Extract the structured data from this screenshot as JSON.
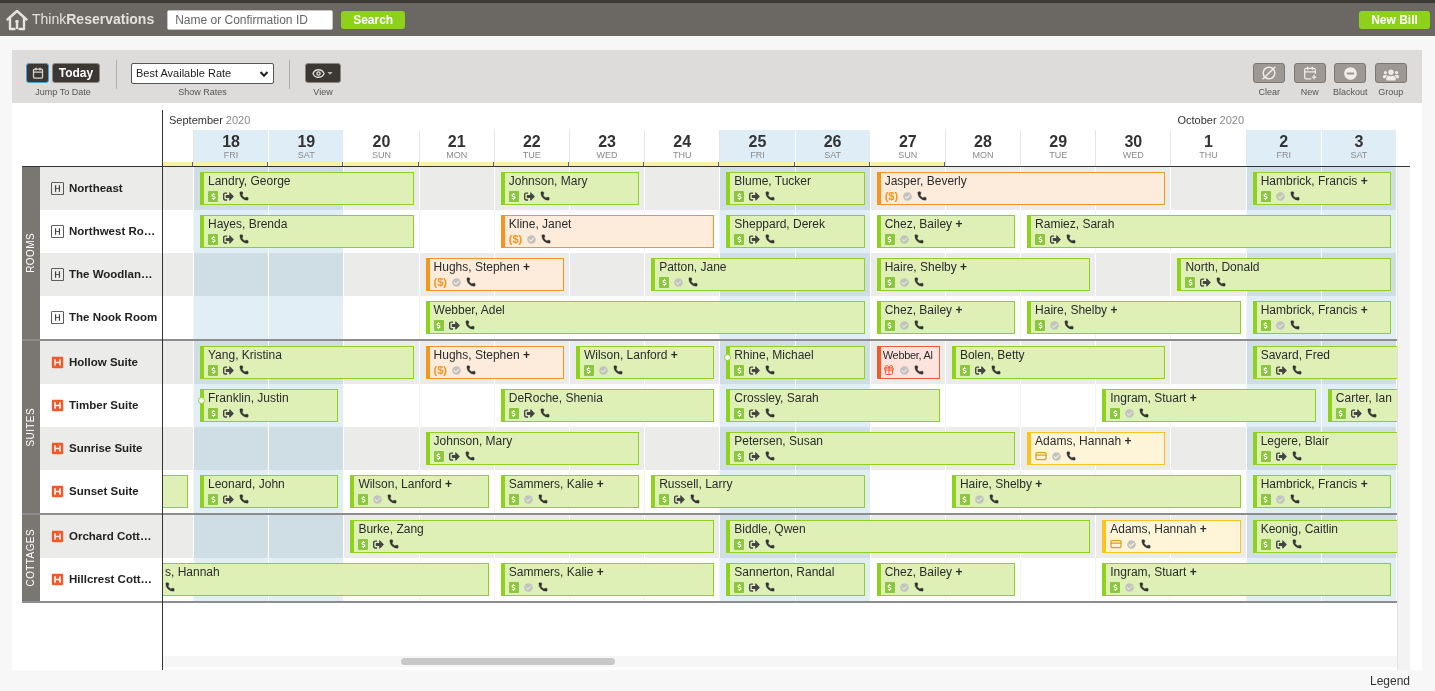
{
  "top_bar": {
    "logo": "Think**Reservations**",
    "search": {
      "placeholder": "Name or Confirmation ID"
    },
    "search_button": "Search",
    "new_bill_button": "New Bill"
  },
  "toolbar": {
    "calendar_button": {
      "focused": true
    },
    "today_button": "Today",
    "jump_label": "Jump To Date",
    "rate_select": {
      "value": "Best Available Rate",
      "label": "Show Rates"
    },
    "view": {
      "label": "View"
    },
    "actions": [
      {
        "kind": "clear",
        "label": "Clear"
      },
      {
        "kind": "new",
        "label": "New"
      },
      {
        "kind": "blackout",
        "label": "Blackout"
      },
      {
        "kind": "group",
        "label": "Group"
      }
    ]
  },
  "calendar": {
    "days": [
      {
        "month": {
          "name": "September",
          "year": "2020"
        },
        "weekend": false,
        "season": true
      },
      {
        "day": "18",
        "weekday": "FRI",
        "weekend": true,
        "season": true
      },
      {
        "day": "19",
        "weekday": "SAT",
        "weekend": true,
        "season": true
      },
      {
        "day": "20",
        "weekday": "SUN",
        "weekend": false,
        "season": true
      },
      {
        "day": "21",
        "weekday": "MON",
        "weekend": false,
        "season": true
      },
      {
        "day": "22",
        "weekday": "TUE",
        "weekend": false,
        "season": true
      },
      {
        "day": "23",
        "weekday": "WED",
        "weekend": false,
        "season": true
      },
      {
        "day": "24",
        "weekday": "THU",
        "weekend": false,
        "season": true
      },
      {
        "day": "25",
        "weekday": "FRI",
        "weekend": true,
        "season": true
      },
      {
        "day": "26",
        "weekday": "SAT",
        "weekend": true,
        "season": true
      },
      {
        "day": "27",
        "weekday": "SUN",
        "weekend": false,
        "season": true
      },
      {
        "day": "28",
        "weekday": "MON",
        "weekend": false,
        "season": false
      },
      {
        "day": "29",
        "weekday": "TUE",
        "weekend": false,
        "season": false
      },
      {
        "day": "30",
        "weekday": "WED",
        "weekend": false,
        "season": false
      },
      {
        "day": "1",
        "weekday": "THU",
        "weekend": false,
        "season": false,
        "month": {
          "name": "October",
          "year": "2020"
        }
      },
      {
        "day": "2",
        "weekday": "FRI",
        "weekend": true,
        "season": false
      },
      {
        "day": "3",
        "weekday": "SAT",
        "weekend": true,
        "season": false
      }
    ],
    "groups": [
      {
        "label": "ROOMS",
        "rooms": [
          {
            "name": "Northeast",
            "kind": "outline",
            "cells": [
              {
                "kind": "free"
              },
              {
                "kind": "confirmed",
                "guest": "Landry, George",
                "icons": [
                  {
                    "kind": "paid"
                  },
                  {
                    "kind": "checked_in"
                  },
                  {
                    "kind": "phone"
                  }
                ],
                "open_start": false,
                "open_end": false,
                "marker": false
              },
              {
                "kind": "continued"
              },
              {
                "kind": "continued"
              },
              {
                "kind": "free"
              },
              {
                "kind": "confirmed",
                "guest": "Johnson, Mary",
                "icons": [
                  {
                    "kind": "paid"
                  },
                  {
                    "kind": "checked_in"
                  },
                  {
                    "kind": "phone"
                  }
                ],
                "open_start": false,
                "open_end": false,
                "marker": false
              },
              {
                "kind": "continued"
              },
              {
                "kind": "free"
              },
              {
                "kind": "confirmed",
                "guest": "Blume, Tucker",
                "icons": [
                  {
                    "kind": "paid"
                  },
                  {
                    "kind": "checked_in"
                  },
                  {
                    "kind": "phone"
                  }
                ],
                "open_start": false,
                "open_end": false,
                "marker": false
              },
              {
                "kind": "continued"
              },
              {
                "kind": "unpaid",
                "guest": "Jasper, Beverly",
                "icons": [
                  {
                    "kind": "due",
                    "label": "($)"
                  },
                  {
                    "kind": "verified"
                  },
                  {
                    "kind": "phone"
                  }
                ],
                "open_start": false,
                "open_end": false,
                "marker": false
              },
              {
                "kind": "continued"
              },
              {
                "kind": "continued"
              },
              {
                "kind": "continued"
              },
              {
                "kind": "free"
              },
              {
                "kind": "confirmed",
                "guest": "Hambrick, Francis **+**",
                "icons": [
                  {
                    "kind": "paid"
                  },
                  {
                    "kind": "verified"
                  },
                  {
                    "kind": "phone"
                  }
                ],
                "open_start": false,
                "open_end": false,
                "marker": false
              },
              {
                "kind": "continued"
              }
            ]
          },
          {
            "name": "Northwest Ro…",
            "kind": "outline",
            "cells": [
              {
                "kind": "free"
              },
              {
                "kind": "confirmed",
                "guest": "Hayes, Brenda",
                "icons": [
                  {
                    "kind": "paid"
                  },
                  {
                    "kind": "checked_in"
                  },
                  {
                    "kind": "phone"
                  }
                ],
                "open_start": false,
                "open_end": false,
                "marker": false
              },
              {
                "kind": "continued"
              },
              {
                "kind": "continued"
              },
              {
                "kind": "free"
              },
              {
                "kind": "unpaid",
                "guest": "Kline, Janet",
                "icons": [
                  {
                    "kind": "due",
                    "label": "($)"
                  },
                  {
                    "kind": "verified"
                  },
                  {
                    "kind": "phone"
                  }
                ],
                "open_start": false,
                "open_end": false,
                "marker": false
              },
              {
                "kind": "continued"
              },
              {
                "kind": "continued"
              },
              {
                "kind": "confirmed",
                "guest": "Sheppard, Derek",
                "icons": [
                  {
                    "kind": "paid"
                  },
                  {
                    "kind": "checked_in"
                  },
                  {
                    "kind": "phone"
                  }
                ],
                "open_start": false,
                "open_end": false,
                "marker": false
              },
              {
                "kind": "continued"
              },
              {
                "kind": "confirmed",
                "guest": "Chez, Bailey **+**",
                "icons": [
                  {
                    "kind": "paid"
                  },
                  {
                    "kind": "verified"
                  },
                  {
                    "kind": "phone"
                  }
                ],
                "open_start": false,
                "open_end": false,
                "marker": false
              },
              {
                "kind": "continued"
              },
              {
                "kind": "confirmed",
                "guest": "Ramiez, Sarah",
                "icons": [
                  {
                    "kind": "paid"
                  },
                  {
                    "kind": "checked_in"
                  },
                  {
                    "kind": "phone"
                  }
                ],
                "open_start": false,
                "open_end": false,
                "marker": false
              },
              {
                "kind": "continued"
              },
              {
                "kind": "continued"
              },
              {
                "kind": "continued"
              },
              {
                "kind": "continued"
              }
            ]
          },
          {
            "name": "The Woodlan…",
            "kind": "outline",
            "cells": [
              {
                "kind": "free"
              },
              {
                "kind": "free"
              },
              {
                "kind": "free"
              },
              {
                "kind": "free"
              },
              {
                "kind": "unpaid",
                "guest": "Hughs, Stephen **+**",
                "icons": [
                  {
                    "kind": "due",
                    "label": "($)"
                  },
                  {
                    "kind": "verified"
                  },
                  {
                    "kind": "phone"
                  }
                ],
                "open_start": false,
                "open_end": false,
                "marker": false
              },
              {
                "kind": "continued"
              },
              {
                "kind": "free"
              },
              {
                "kind": "confirmed",
                "guest": "Patton, Jane",
                "icons": [
                  {
                    "kind": "paid"
                  },
                  {
                    "kind": "verified"
                  },
                  {
                    "kind": "phone"
                  }
                ],
                "open_start": false,
                "open_end": false,
                "marker": false
              },
              {
                "kind": "continued"
              },
              {
                "kind": "continued"
              },
              {
                "kind": "confirmed",
                "guest": "Haire, Shelby **+**",
                "icons": [
                  {
                    "kind": "paid"
                  },
                  {
                    "kind": "verified"
                  },
                  {
                    "kind": "phone"
                  }
                ],
                "open_start": false,
                "open_end": false,
                "marker": false
              },
              {
                "kind": "continued"
              },
              {
                "kind": "continued"
              },
              {
                "kind": "free"
              },
              {
                "kind": "confirmed",
                "guest": "North, Donald",
                "icons": [
                  {
                    "kind": "paid"
                  },
                  {
                    "kind": "checked_in"
                  },
                  {
                    "kind": "phone"
                  }
                ],
                "open_start": false,
                "open_end": false,
                "marker": false
              },
              {
                "kind": "continued"
              },
              {
                "kind": "continued"
              }
            ]
          },
          {
            "name": "The Nook Room",
            "kind": "outline",
            "cells": [
              {
                "kind": "free"
              },
              {
                "kind": "free"
              },
              {
                "kind": "free"
              },
              {
                "kind": "free"
              },
              {
                "kind": "confirmed",
                "guest": "Webber, Adel",
                "icons": [
                  {
                    "kind": "paid"
                  },
                  {
                    "kind": "checked_in"
                  },
                  {
                    "kind": "phone"
                  }
                ],
                "open_start": false,
                "open_end": false,
                "marker": false
              },
              {
                "kind": "continued"
              },
              {
                "kind": "continued"
              },
              {
                "kind": "continued"
              },
              {
                "kind": "continued"
              },
              {
                "kind": "continued"
              },
              {
                "kind": "confirmed",
                "guest": "Chez, Bailey **+**",
                "icons": [
                  {
                    "kind": "paid"
                  },
                  {
                    "kind": "verified"
                  },
                  {
                    "kind": "phone"
                  }
                ],
                "open_start": false,
                "open_end": false,
                "marker": false
              },
              {
                "kind": "continued"
              },
              {
                "kind": "confirmed",
                "guest": "Haire, Shelby **+**",
                "icons": [
                  {
                    "kind": "paid"
                  },
                  {
                    "kind": "verified"
                  },
                  {
                    "kind": "phone"
                  }
                ],
                "open_start": false,
                "open_end": false,
                "marker": false
              },
              {
                "kind": "continued"
              },
              {
                "kind": "continued"
              },
              {
                "kind": "confirmed",
                "guest": "Hambrick, Francis **+**",
                "icons": [
                  {
                    "kind": "paid"
                  },
                  {
                    "kind": "verified"
                  },
                  {
                    "kind": "phone"
                  }
                ],
                "open_start": false,
                "open_end": false,
                "marker": false
              },
              {
                "kind": "continued"
              }
            ]
          }
        ]
      },
      {
        "label": "SUITES",
        "rooms": [
          {
            "name": "Hollow Suite",
            "kind": "filled",
            "cells": [
              {
                "kind": "free"
              },
              {
                "kind": "confirmed",
                "guest": "Yang, Kristina",
                "icons": [
                  {
                    "kind": "paid"
                  },
                  {
                    "kind": "checked_in"
                  },
                  {
                    "kind": "phone"
                  }
                ],
                "open_start": false,
                "open_end": false,
                "marker": false
              },
              {
                "kind": "continued"
              },
              {
                "kind": "continued"
              },
              {
                "kind": "unpaid",
                "guest": "Hughs, Stephen **+**",
                "icons": [
                  {
                    "kind": "due",
                    "label": "($)"
                  },
                  {
                    "kind": "verified"
                  },
                  {
                    "kind": "phone"
                  }
                ],
                "open_start": false,
                "open_end": false,
                "marker": false
              },
              {
                "kind": "continued"
              },
              {
                "kind": "confirmed",
                "guest": "Wilson, Lanford **+**",
                "icons": [
                  {
                    "kind": "paid"
                  },
                  {
                    "kind": "verified"
                  },
                  {
                    "kind": "phone"
                  }
                ],
                "open_start": false,
                "open_end": false,
                "marker": false
              },
              {
                "kind": "continued"
              },
              {
                "kind": "confirmed",
                "guest": "Rhine, Michael",
                "icons": [
                  {
                    "kind": "paid"
                  },
                  {
                    "kind": "checked_in"
                  },
                  {
                    "kind": "phone"
                  }
                ],
                "open_start": false,
                "open_end": false,
                "marker": true
              },
              {
                "kind": "continued"
              },
              {
                "kind": "issue",
                "guest": "Webber, Al",
                "icons": [
                  {
                    "kind": "gift"
                  },
                  {
                    "kind": "verified"
                  },
                  {
                    "kind": "phone"
                  }
                ],
                "open_start": false,
                "open_end": false,
                "marker": false
              },
              {
                "kind": "confirmed",
                "guest": "Bolen, Betty",
                "icons": [
                  {
                    "kind": "paid"
                  },
                  {
                    "kind": "checked_in"
                  },
                  {
                    "kind": "phone"
                  }
                ],
                "open_start": false,
                "open_end": false,
                "marker": false
              },
              {
                "kind": "continued"
              },
              {
                "kind": "continued"
              },
              {
                "kind": "free"
              },
              {
                "kind": "confirmed",
                "guest": "Savard, Fred",
                "icons": [
                  {
                    "kind": "paid"
                  },
                  {
                    "kind": "checked_in"
                  },
                  {
                    "kind": "phone"
                  }
                ],
                "open_start": false,
                "open_end": true,
                "marker": false
              },
              {
                "kind": "continued"
              }
            ]
          },
          {
            "name": "Timber Suite",
            "kind": "filled",
            "cells": [
              {
                "kind": "free"
              },
              {
                "kind": "confirmed",
                "guest": "Franklin, Justin",
                "icons": [
                  {
                    "kind": "paid"
                  },
                  {
                    "kind": "checked_in"
                  },
                  {
                    "kind": "phone"
                  }
                ],
                "open_start": false,
                "open_end": false,
                "marker": true
              },
              {
                "kind": "continued"
              },
              {
                "kind": "free"
              },
              {
                "kind": "free"
              },
              {
                "kind": "confirmed",
                "guest": "DeRoche, Shenia",
                "icons": [
                  {
                    "kind": "paid"
                  },
                  {
                    "kind": "checked_in"
                  },
                  {
                    "kind": "phone"
                  }
                ],
                "open_start": false,
                "open_end": false,
                "marker": false
              },
              {
                "kind": "continued"
              },
              {
                "kind": "continued"
              },
              {
                "kind": "confirmed",
                "guest": "Crossley, Sarah",
                "icons": [
                  {
                    "kind": "paid"
                  },
                  {
                    "kind": "checked_in"
                  },
                  {
                    "kind": "phone"
                  }
                ],
                "open_start": false,
                "open_end": false,
                "marker": false
              },
              {
                "kind": "continued"
              },
              {
                "kind": "continued"
              },
              {
                "kind": "free"
              },
              {
                "kind": "free"
              },
              {
                "kind": "confirmed",
                "guest": "Ingram, Stuart **+**",
                "icons": [
                  {
                    "kind": "paid"
                  },
                  {
                    "kind": "verified"
                  },
                  {
                    "kind": "phone"
                  }
                ],
                "open_start": false,
                "open_end": false,
                "marker": false
              },
              {
                "kind": "continued"
              },
              {
                "kind": "continued"
              },
              {
                "kind": "confirmed",
                "guest": "Carter, Ian",
                "icons": [
                  {
                    "kind": "paid"
                  },
                  {
                    "kind": "checked_in"
                  },
                  {
                    "kind": "phone"
                  }
                ],
                "open_start": false,
                "open_end": true,
                "marker": false
              }
            ]
          },
          {
            "name": "Sunrise Suite",
            "kind": "filled",
            "cells": [
              {
                "kind": "free"
              },
              {
                "kind": "free"
              },
              {
                "kind": "free"
              },
              {
                "kind": "free"
              },
              {
                "kind": "confirmed",
                "guest": "Johnson, Mary",
                "icons": [
                  {
                    "kind": "paid"
                  },
                  {
                    "kind": "checked_in"
                  },
                  {
                    "kind": "phone"
                  }
                ],
                "open_start": false,
                "open_end": false,
                "marker": false
              },
              {
                "kind": "continued"
              },
              {
                "kind": "continued"
              },
              {
                "kind": "free"
              },
              {
                "kind": "confirmed",
                "guest": "Petersen, Susan",
                "icons": [
                  {
                    "kind": "paid"
                  },
                  {
                    "kind": "checked_in"
                  },
                  {
                    "kind": "phone"
                  }
                ],
                "open_start": false,
                "open_end": false,
                "marker": false
              },
              {
                "kind": "continued"
              },
              {
                "kind": "continued"
              },
              {
                "kind": "continued"
              },
              {
                "kind": "tentative",
                "guest": "Adams, Hannah **+**",
                "icons": [
                  {
                    "kind": "card"
                  },
                  {
                    "kind": "verified"
                  },
                  {
                    "kind": "phone"
                  }
                ],
                "open_start": false,
                "open_end": false,
                "marker": false
              },
              {
                "kind": "continued"
              },
              {
                "kind": "free"
              },
              {
                "kind": "confirmed",
                "guest": "Legere, Blair",
                "icons": [
                  {
                    "kind": "paid"
                  },
                  {
                    "kind": "checked_in"
                  },
                  {
                    "kind": "phone"
                  }
                ],
                "open_start": false,
                "open_end": true,
                "marker": false
              },
              {
                "kind": "continued"
              }
            ]
          },
          {
            "name": "Sunset Suite",
            "kind": "filled",
            "cells": [
              {
                "kind": "confirmed",
                "open_start": true,
                "open_end": false,
                "marker": false
              },
              {
                "kind": "confirmed",
                "guest": "Leonard, John",
                "icons": [
                  {
                    "kind": "paid"
                  },
                  {
                    "kind": "checked_in"
                  },
                  {
                    "kind": "phone"
                  }
                ],
                "open_start": false,
                "open_end": false,
                "marker": false
              },
              {
                "kind": "continued"
              },
              {
                "kind": "confirmed",
                "guest": "Wilson, Lanford **+**",
                "icons": [
                  {
                    "kind": "paid"
                  },
                  {
                    "kind": "verified"
                  },
                  {
                    "kind": "phone"
                  }
                ],
                "open_start": false,
                "open_end": false,
                "marker": false
              },
              {
                "kind": "continued"
              },
              {
                "kind": "confirmed",
                "guest": "Sammers, Kalie **+**",
                "icons": [
                  {
                    "kind": "paid"
                  },
                  {
                    "kind": "verified"
                  },
                  {
                    "kind": "phone"
                  }
                ],
                "open_start": false,
                "open_end": false,
                "marker": false
              },
              {
                "kind": "continued"
              },
              {
                "kind": "confirmed",
                "guest": "Russell, Larry",
                "icons": [
                  {
                    "kind": "paid"
                  },
                  {
                    "kind": "checked_in"
                  },
                  {
                    "kind": "phone"
                  }
                ],
                "open_start": false,
                "open_end": false,
                "marker": false
              },
              {
                "kind": "continued"
              },
              {
                "kind": "continued"
              },
              {
                "kind": "free"
              },
              {
                "kind": "confirmed",
                "guest": "Haire, Shelby **+**",
                "icons": [
                  {
                    "kind": "paid"
                  },
                  {
                    "kind": "verified"
                  },
                  {
                    "kind": "phone"
                  }
                ],
                "open_start": false,
                "open_end": false,
                "marker": false
              },
              {
                "kind": "continued"
              },
              {
                "kind": "continued"
              },
              {
                "kind": "continued"
              },
              {
                "kind": "confirmed",
                "guest": "Hambrick, Francis **+**",
                "icons": [
                  {
                    "kind": "paid"
                  },
                  {
                    "kind": "verified"
                  },
                  {
                    "kind": "phone"
                  }
                ],
                "open_start": false,
                "open_end": false,
                "marker": false
              },
              {
                "kind": "continued"
              }
            ]
          }
        ]
      },
      {
        "label": "COTTAGES",
        "rooms": [
          {
            "name": "Orchard Cott…",
            "kind": "filled",
            "cells": [
              {
                "kind": "free"
              },
              {
                "kind": "free"
              },
              {
                "kind": "free"
              },
              {
                "kind": "confirmed",
                "guest": "Burke, Zang",
                "icons": [
                  {
                    "kind": "paid"
                  },
                  {
                    "kind": "checked_in"
                  },
                  {
                    "kind": "phone"
                  }
                ],
                "open_start": false,
                "open_end": false,
                "marker": false
              },
              {
                "kind": "continued"
              },
              {
                "kind": "continued"
              },
              {
                "kind": "continued"
              },
              {
                "kind": "continued"
              },
              {
                "kind": "confirmed",
                "guest": "Biddle, Qwen",
                "icons": [
                  {
                    "kind": "paid"
                  },
                  {
                    "kind": "checked_in"
                  },
                  {
                    "kind": "phone"
                  }
                ],
                "open_start": false,
                "open_end": false,
                "marker": false
              },
              {
                "kind": "continued"
              },
              {
                "kind": "continued"
              },
              {
                "kind": "continued"
              },
              {
                "kind": "continued"
              },
              {
                "kind": "tentative",
                "guest": "Adams, Hannah **+**",
                "icons": [
                  {
                    "kind": "card"
                  },
                  {
                    "kind": "verified"
                  },
                  {
                    "kind": "phone"
                  }
                ],
                "open_start": false,
                "open_end": false,
                "marker": false
              },
              {
                "kind": "continued"
              },
              {
                "kind": "confirmed",
                "guest": "Keonig, Caitlin",
                "icons": [
                  {
                    "kind": "paid"
                  },
                  {
                    "kind": "checked_in"
                  },
                  {
                    "kind": "phone"
                  }
                ],
                "open_start": false,
                "open_end": true,
                "marker": false
              },
              {
                "kind": "continued"
              }
            ]
          },
          {
            "name": "Hillcrest Cott…",
            "kind": "filled",
            "cells": [
              {
                "kind": "confirmed",
                "guest": "s, Hannah",
                "icons": [
                  {
                    "kind": "phone"
                  }
                ],
                "open_start": true,
                "open_end": false,
                "marker": false
              },
              {
                "kind": "continued"
              },
              {
                "kind": "continued"
              },
              {
                "kind": "continued"
              },
              {
                "kind": "continued"
              },
              {
                "kind": "confirmed",
                "guest": "Sammers, Kalie **+**",
                "icons": [
                  {
                    "kind": "paid"
                  },
                  {
                    "kind": "verified"
                  },
                  {
                    "kind": "phone"
                  }
                ],
                "open_start": false,
                "open_end": false,
                "marker": false
              },
              {
                "kind": "continued"
              },
              {
                "kind": "continued"
              },
              {
                "kind": "confirmed",
                "guest": "Sannerton, Randal",
                "icons": [
                  {
                    "kind": "paid"
                  },
                  {
                    "kind": "checked_in"
                  },
                  {
                    "kind": "phone"
                  }
                ],
                "open_start": false,
                "open_end": false,
                "marker": false
              },
              {
                "kind": "continued"
              },
              {
                "kind": "confirmed",
                "guest": "Chez, Bailey **+**",
                "icons": [
                  {
                    "kind": "paid"
                  },
                  {
                    "kind": "verified"
                  },
                  {
                    "kind": "phone"
                  }
                ],
                "open_start": false,
                "open_end": false,
                "marker": false
              },
              {
                "kind": "continued"
              },
              {
                "kind": "free"
              },
              {
                "kind": "confirmed",
                "guest": "Ingram, Stuart **+**",
                "icons": [
                  {
                    "kind": "paid"
                  },
                  {
                    "kind": "verified"
                  },
                  {
                    "kind": "phone"
                  }
                ],
                "open_start": false,
                "open_end": false,
                "marker": false
              },
              {
                "kind": "continued"
              },
              {
                "kind": "continued"
              },
              {
                "kind": "continued"
              }
            ]
          }
        ]
      }
    ]
  },
  "legend": "Legend"
}
